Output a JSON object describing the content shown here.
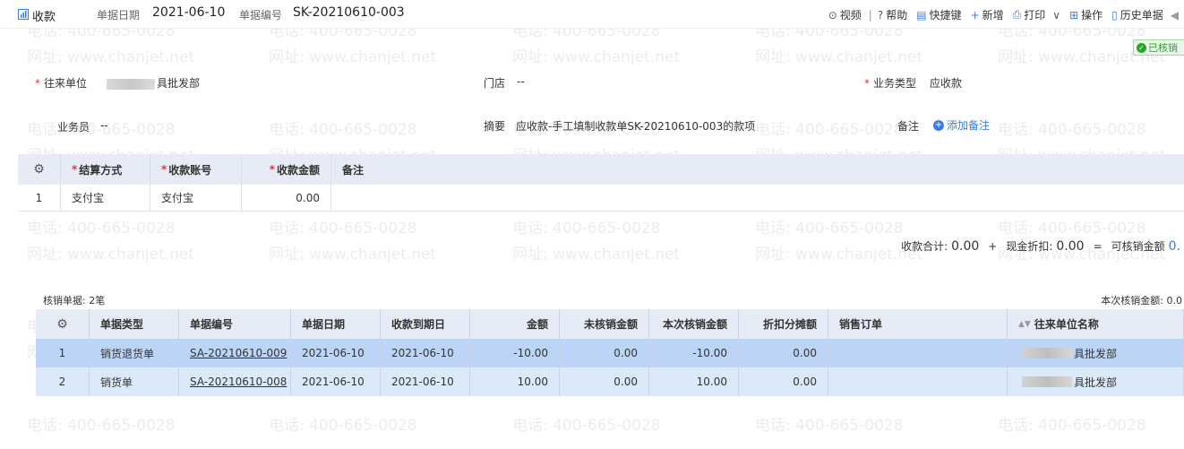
{
  "header": {
    "tab_label": "收款",
    "date_label": "单据日期",
    "date_value": "2021-06-10",
    "no_label": "单据编号",
    "no_value": "SK-20210610-003"
  },
  "toolbar": {
    "video": "视频",
    "help": "帮助",
    "shortcut": "快捷键",
    "add": "新增",
    "print": "打印",
    "operate": "操作",
    "history": "历史单据"
  },
  "badge": "已核销",
  "form": {
    "partner_label": "往来单位",
    "partner_value": "具批发部",
    "store_label": "门店",
    "store_value": "--",
    "biztype_label": "业务类型",
    "biztype_value": "应收款",
    "salesman_label": "业务员",
    "salesman_value": "--",
    "summary_label": "摘要",
    "summary_value": "应收款-手工填制收款单SK-20210610-003的款项",
    "remark_label": "备注",
    "remark_add": "添加备注"
  },
  "payment_table": {
    "columns": [
      "结算方式",
      "收款账号",
      "收款金额",
      "备注"
    ],
    "rows": [
      {
        "idx": "1",
        "method": "支付宝",
        "account": "支付宝",
        "amount": "0.00",
        "remark": ""
      }
    ]
  },
  "totals": {
    "received_label": "收款合计:",
    "received_value": "0.00",
    "plus": "+",
    "discount_label": "现金折扣:",
    "discount_value": "0.00",
    "equals": "=",
    "writeoff_label": "可核销金额",
    "writeoff_value": "0."
  },
  "writeoff": {
    "count_label": "核销单据: 2笔",
    "current_label": "本次核销金额: 0.0"
  },
  "writeoff_table": {
    "columns": [
      "单据类型",
      "单据编号",
      "单据日期",
      "收款到期日",
      "金额",
      "未核销金额",
      "本次核销金额",
      "折扣分摊额",
      "销售订单",
      "往来单位名称"
    ],
    "rows": [
      {
        "idx": "1",
        "type": "销货退货单",
        "no": "SA-20210610-009",
        "date": "2021-06-10",
        "due": "2021-06-10",
        "amount": "-10.00",
        "unwritten": "0.00",
        "current": "-10.00",
        "discount": "0.00",
        "order": "",
        "partner": "具批发部"
      },
      {
        "idx": "2",
        "type": "销货单",
        "no": "SA-20210610-008",
        "date": "2021-06-10",
        "due": "2021-06-10",
        "amount": "10.00",
        "unwritten": "0.00",
        "current": "10.00",
        "discount": "0.00",
        "order": "",
        "partner": "具批发部"
      }
    ]
  },
  "watermark": {
    "phone": "电话: 400-665-0028",
    "site": "网址: www.chanjet.net"
  },
  "colors": {
    "accent": "#3b7ddd",
    "header_bg": "#e7ebf5",
    "selected_row": "#bcd4f5",
    "success": "#2aa52a",
    "required": "#e33333"
  }
}
